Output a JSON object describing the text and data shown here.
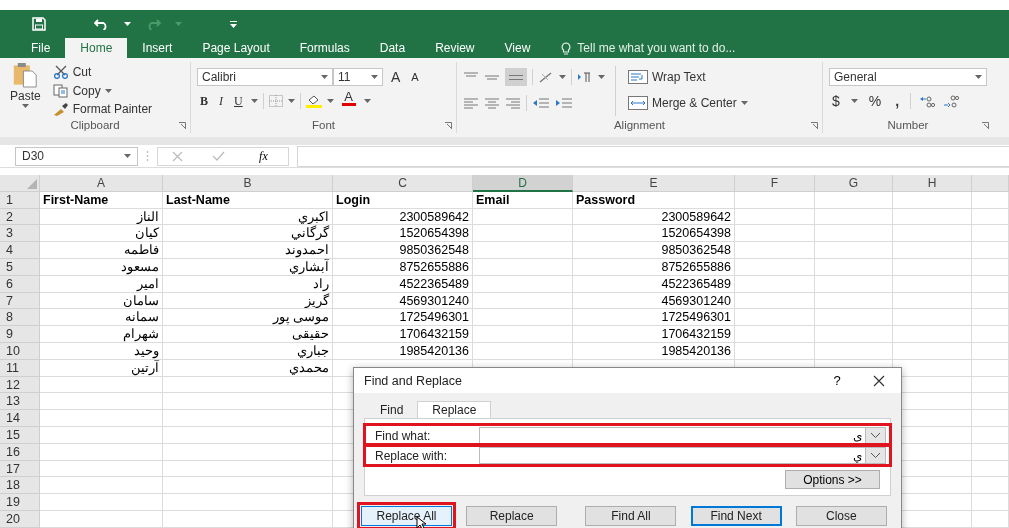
{
  "ribbon_tabs": [
    {
      "label": "File",
      "selected": false
    },
    {
      "label": "Home",
      "selected": true
    },
    {
      "label": "Insert",
      "selected": false
    },
    {
      "label": "Page Layout",
      "selected": false
    },
    {
      "label": "Formulas",
      "selected": false
    },
    {
      "label": "Data",
      "selected": false
    },
    {
      "label": "Review",
      "selected": false
    },
    {
      "label": "View",
      "selected": false
    }
  ],
  "tell_me": {
    "placeholder": "Tell me what you want to do..."
  },
  "ribbon": {
    "clipboard": {
      "label": "Clipboard",
      "paste": "Paste",
      "cut": "Cut",
      "copy": "Copy",
      "format_painter": "Format Painter"
    },
    "font": {
      "label": "Font",
      "font_name": "Calibri",
      "font_size": "11",
      "grow": "A",
      "shrink": "A",
      "bold": "B",
      "italic": "I",
      "underline": "U",
      "font_color": "A"
    },
    "alignment": {
      "label": "Alignment",
      "wrap_text": "Wrap Text",
      "merge_center": "Merge & Center"
    },
    "number": {
      "label": "Number",
      "format": "General",
      "currency": "$",
      "percent": "%",
      "comma": ","
    }
  },
  "name_box": "D30",
  "function_label": "fx",
  "columns": [
    {
      "label": "A",
      "selected": false
    },
    {
      "label": "B",
      "selected": false
    },
    {
      "label": "C",
      "selected": false
    },
    {
      "label": "D",
      "selected": true
    },
    {
      "label": "E",
      "selected": false
    },
    {
      "label": "F",
      "selected": false
    },
    {
      "label": "G",
      "selected": false
    },
    {
      "label": "H",
      "selected": false
    }
  ],
  "header_row": {
    "number": "1",
    "cells": {
      "A": "First-Name",
      "B": "Last-Name",
      "C": "Login",
      "D": "Email",
      "E": "Password"
    }
  },
  "rows": [
    {
      "number": "2",
      "cells": {
        "A": "الناز",
        "B": "اکبري",
        "C": "2300589642",
        "E": "2300589642"
      }
    },
    {
      "number": "3",
      "cells": {
        "A": "کیان",
        "B": "گرگاني",
        "C": "1520654398",
        "E": "1520654398"
      }
    },
    {
      "number": "4",
      "cells": {
        "A": "فاطمه",
        "B": "احمدوند",
        "C": "9850362548",
        "E": "9850362548"
      }
    },
    {
      "number": "5",
      "cells": {
        "A": "مسعود",
        "B": "آبشاري",
        "C": "8752655886",
        "E": "8752655886"
      }
    },
    {
      "number": "6",
      "cells": {
        "A": "امیر",
        "B": "راد",
        "C": "4522365489",
        "E": "4522365489"
      }
    },
    {
      "number": "7",
      "cells": {
        "A": "سامان",
        "B": "گریز",
        "C": "4569301240",
        "E": "4569301240"
      }
    },
    {
      "number": "8",
      "cells": {
        "A": "سمانه",
        "B": "موسی پور",
        "C": "1725496301",
        "E": "1725496301"
      }
    },
    {
      "number": "9",
      "cells": {
        "A": "شهرام",
        "B": "حقیقی",
        "C": "1706432159",
        "E": "1706432159"
      }
    },
    {
      "number": "10",
      "cells": {
        "A": "وحید",
        "B": "جباري",
        "C": "1985420136",
        "E": "1985420136"
      }
    },
    {
      "number": "11",
      "cells": {
        "A": "آرتین",
        "B": "محمدي"
      }
    },
    {
      "number": "12"
    },
    {
      "number": "13"
    },
    {
      "number": "14"
    },
    {
      "number": "15"
    },
    {
      "number": "16"
    },
    {
      "number": "17"
    },
    {
      "number": "18"
    },
    {
      "number": "19"
    },
    {
      "number": "20"
    }
  ],
  "dialog": {
    "title": "Find and Replace",
    "help": "?",
    "tabs": [
      {
        "label": "Find",
        "selected": false
      },
      {
        "label": "Replace",
        "selected": true
      }
    ],
    "fields": [
      {
        "label": "Find what:",
        "value": "ی",
        "highlighted": true
      },
      {
        "label": "Replace with:",
        "value": "ي",
        "highlighted": true
      }
    ],
    "options_button": "Options >>",
    "buttons": [
      {
        "label": "Replace All",
        "highlighted": true,
        "hovered": true,
        "default": false
      },
      {
        "label": "Replace",
        "highlighted": false,
        "hovered": false,
        "default": false
      },
      {
        "label": "Find All",
        "highlighted": false,
        "hovered": false,
        "default": false
      },
      {
        "label": "Find Next",
        "highlighted": false,
        "hovered": false,
        "default": true
      },
      {
        "label": "Close",
        "highlighted": false,
        "hovered": false,
        "default": false
      }
    ]
  }
}
